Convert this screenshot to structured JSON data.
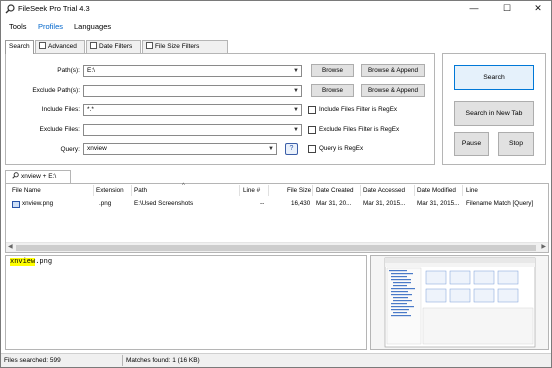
{
  "window": {
    "title": "FileSeek Pro Trial 4.3",
    "minimize": "—",
    "maximize": "☐",
    "close": "✕"
  },
  "menu": [
    "Tools",
    "Profiles",
    "Languages"
  ],
  "tabs": [
    "Search",
    "Advanced",
    "Date Filters",
    "File Size Filters"
  ],
  "fields": {
    "paths": {
      "label": "Path(s):",
      "value": "E:\\"
    },
    "exclude_paths": {
      "label": "Exclude Path(s):",
      "value": ""
    },
    "include_files": {
      "label": "Include Files:",
      "value": "*.*"
    },
    "exclude_files": {
      "label": "Exclude Files:",
      "value": ""
    },
    "query": {
      "label": "Query:",
      "value": "xnview"
    }
  },
  "buttons": {
    "browse": "Browse",
    "browse_append": "Browse & Append",
    "search": "Search",
    "search_new_tab": "Search in New Tab",
    "pause": "Pause",
    "stop": "Stop",
    "help": "?"
  },
  "checkboxes": {
    "include_regex": "Include Files Filter is RegEx",
    "exclude_regex": "Exclude Files Filter is RegEx",
    "query_regex": "Query is RegEx"
  },
  "results_tab": "xnview + E:\\",
  "columns": [
    "File Name",
    "Extension",
    "Path",
    "Line #",
    "File Size",
    "Date Created",
    "Date Accessed",
    "Date Modified",
    "Line"
  ],
  "rows": [
    [
      "xnview.png",
      ".png",
      "E:\\Used Screenshots",
      "--",
      "16,430",
      "Mar 31, 20...",
      "Mar 31, 2015...",
      "Mar 31, 2015...",
      "Filename Match [Query]"
    ]
  ],
  "preview": {
    "match": "xnview",
    "rest": ".png"
  },
  "status": {
    "searched": "Files searched: 599",
    "matches": "Matches found: 1 (16 KB)"
  },
  "colors": {
    "accent": "#0078d7",
    "highlight": "#ffff00"
  }
}
